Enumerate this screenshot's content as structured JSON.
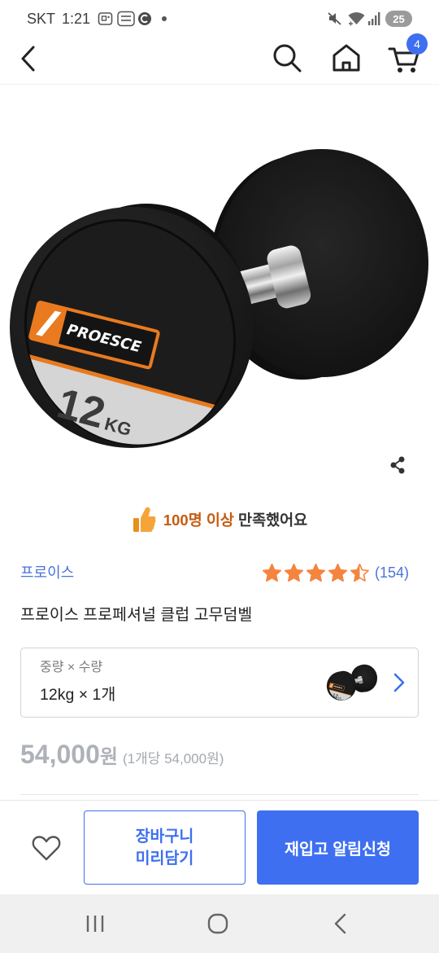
{
  "status_bar": {
    "carrier": "SKT",
    "time": "1:21",
    "battery": "25",
    "notification_icons": [
      "gallery-icon",
      "temu-app-icon",
      "c-app-icon",
      "more-dot-icon"
    ],
    "system_icons": [
      "mute-icon",
      "wifi-icon",
      "signal-icon",
      "battery-icon"
    ]
  },
  "header": {
    "icons": [
      "back-icon",
      "search-icon",
      "home-icon",
      "cart-icon"
    ],
    "cart_badge": "4"
  },
  "product_image": {
    "logo_text": "PROESCE",
    "weight_number": "12",
    "weight_unit": "KG",
    "share_icon": "share-icon"
  },
  "satisfaction": {
    "icon": "thumbs-up-icon",
    "highlight": "100명 이상",
    "text": "만족했어요"
  },
  "product": {
    "brand": "프로이스",
    "rating": {
      "value": 4.5,
      "max": 5,
      "count_label": "(154)"
    },
    "title": "프로이스 프로페셔널 클럽 고무덤벨"
  },
  "option": {
    "label": "중량 × 수량",
    "value": "12kg × 1개",
    "icon": "chevron-right-icon"
  },
  "price": {
    "amount": "54,000",
    "currency": "원",
    "unit_price": "(1개당 54,000원)"
  },
  "actions": {
    "wishlist_icon": "heart-icon",
    "cart_line1": "장바구니",
    "cart_line2": "미리담기",
    "restock": "재입고 알림신청"
  },
  "nav_bar": {
    "icons": [
      "recent-apps-icon",
      "home-button-icon",
      "back-button-icon"
    ]
  },
  "colors": {
    "accent": "#3d6ff0",
    "brand_link": "#4a73d9",
    "highlight": "#c65b10",
    "star": "#f5843f",
    "price": "#aeb2b8",
    "logo_orange": "#e97a1f"
  }
}
